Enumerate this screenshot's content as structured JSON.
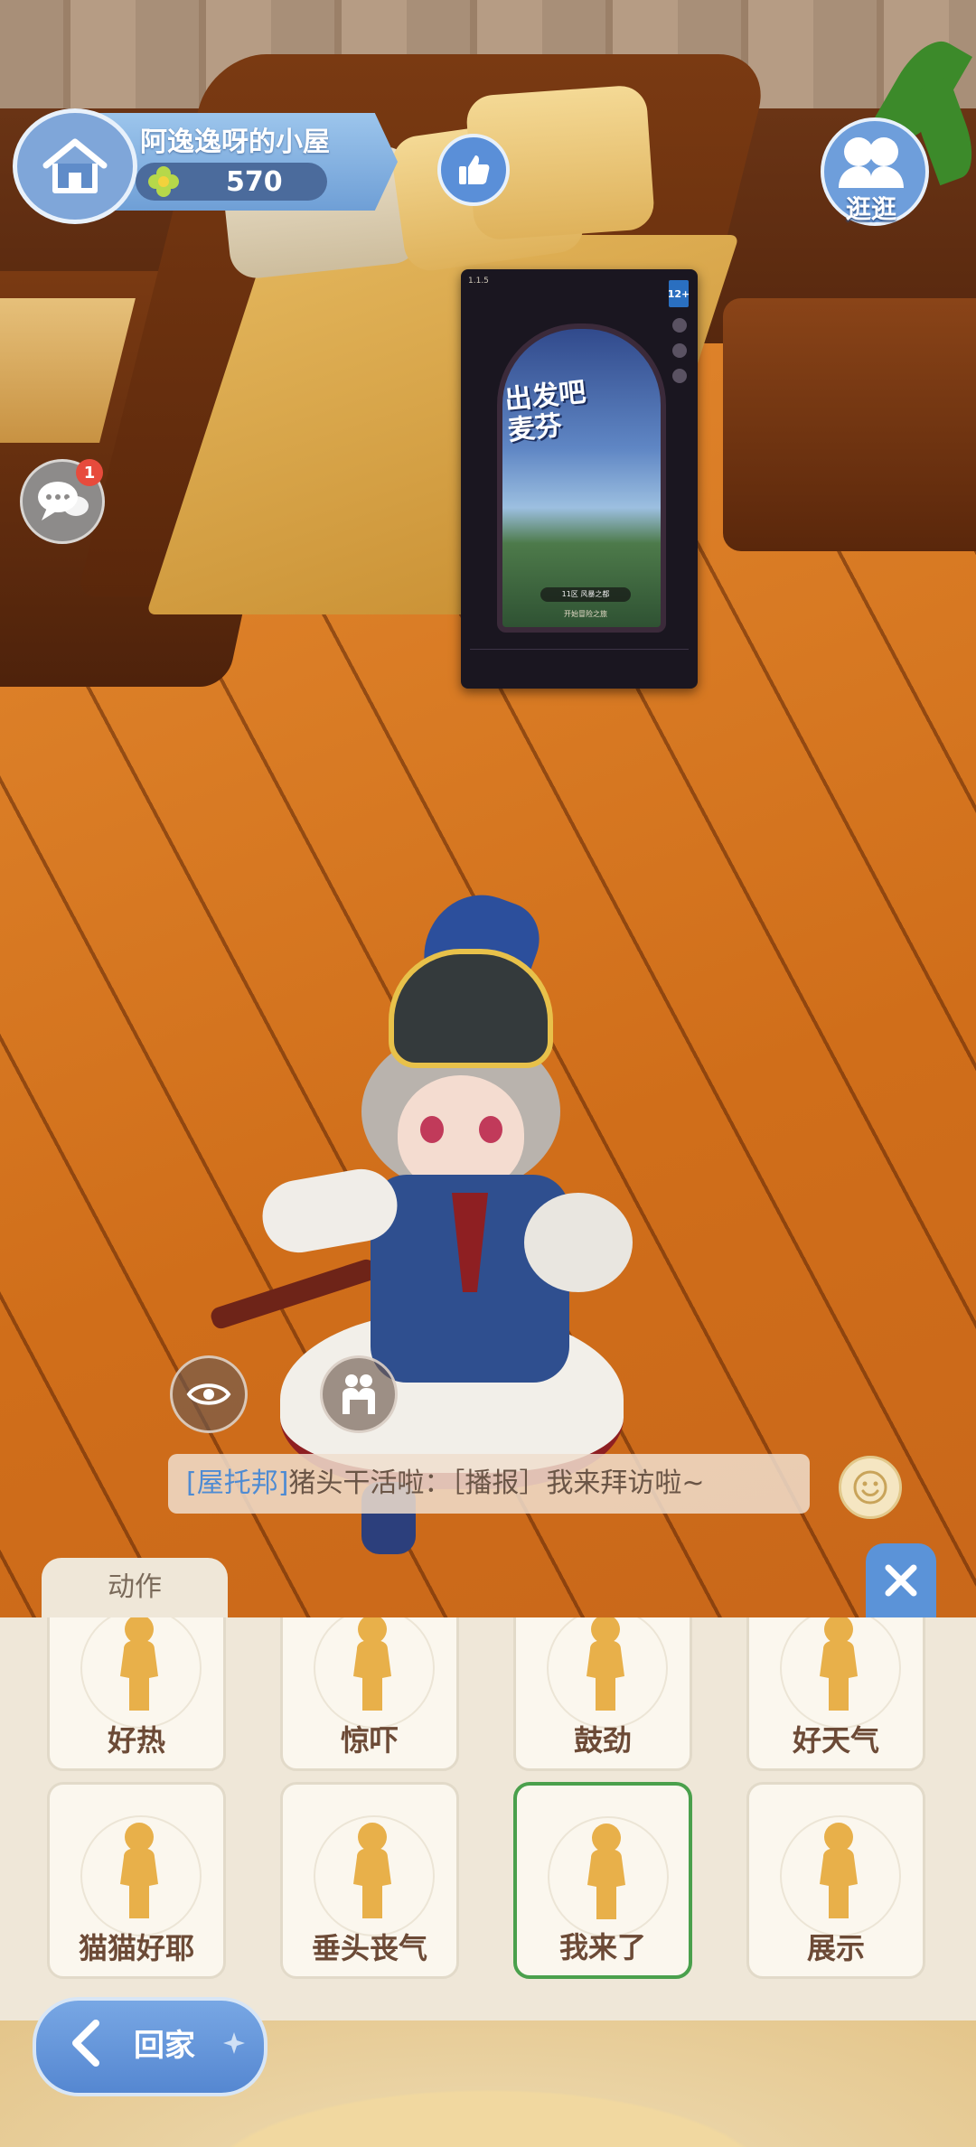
{
  "home": {
    "name": "阿逸逸呀的小屋",
    "score": "570"
  },
  "visit": {
    "label": "逛逛"
  },
  "chat": {
    "badge": "1"
  },
  "poster": {
    "title": "出发吧\n麦芬",
    "rating": "12+",
    "button_text": "11区 风暴之都",
    "start_text": "开始冒险之旅"
  },
  "message": {
    "channel": "[屋托邦]",
    "text": "猪头干活啦：［播报］我来拜访啦~"
  },
  "panel": {
    "tab": "动作",
    "row1": [
      "好热",
      "惊吓",
      "鼓劲",
      "好天气"
    ],
    "row2": [
      "猫猫好耶",
      "垂头丧气",
      "我来了",
      "展示"
    ],
    "selected": "我来了"
  },
  "bottom": {
    "go_home": "回家"
  },
  "colors": {
    "accent_blue": "#5b93d8",
    "selected_green": "#4aa04c",
    "badge_red": "#e74b3c",
    "panel_bg": "#efe7d8"
  }
}
